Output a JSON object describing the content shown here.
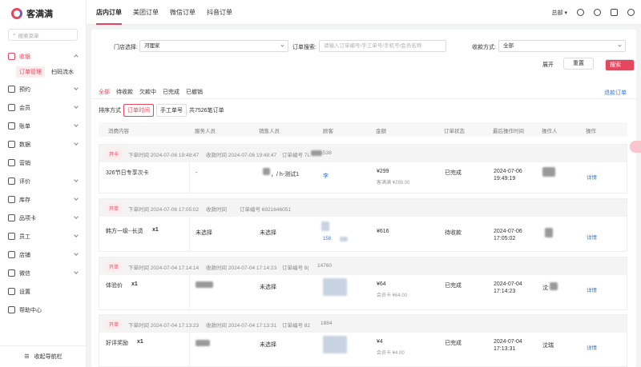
{
  "app": {
    "name": "客满满"
  },
  "sidebar": {
    "search_placeholder": "搜索菜单",
    "items": [
      {
        "label": "收银",
        "icon": "cashier-icon"
      },
      {
        "label": "预约",
        "icon": "calendar-icon"
      },
      {
        "label": "会员",
        "icon": "member-icon"
      },
      {
        "label": "账单",
        "icon": "bill-icon"
      },
      {
        "label": "数据",
        "icon": "data-icon"
      },
      {
        "label": "营销",
        "icon": "marketing-icon"
      },
      {
        "label": "评价",
        "icon": "review-icon"
      },
      {
        "label": "库存",
        "icon": "inventory-icon"
      },
      {
        "label": "品项卡",
        "icon": "card-icon"
      },
      {
        "label": "员工",
        "icon": "staff-icon"
      },
      {
        "label": "店铺",
        "icon": "store-icon"
      },
      {
        "label": "微信",
        "icon": "wechat-icon"
      },
      {
        "label": "设置",
        "icon": "gear-icon"
      },
      {
        "label": "帮助中心",
        "icon": "help-icon"
      }
    ],
    "sub_items": [
      "订单管理",
      "扫码流水"
    ],
    "collapse_label": "收起导航栏"
  },
  "topbar": {
    "tabs": [
      "店内订单",
      "美团订单",
      "微信订单",
      "抖音订单"
    ],
    "account": "总部"
  },
  "filters": {
    "store_label": "门店选择:",
    "store_value": "河狸家",
    "order_search_label": "订单搜索:",
    "order_search_placeholder": "请输入订单编号/手工单号/手机号/会员名称",
    "pay_label": "收款方式:",
    "pay_value": "全部",
    "expand": "展开",
    "reset": "重置",
    "search": "搜索"
  },
  "status_tabs": [
    "全部",
    "待收款",
    "欠款中",
    "已完成",
    "已撤销"
  ],
  "refund_link": "退款订单",
  "sort": {
    "label": "排序方式",
    "by_time": "订单时间",
    "by_manual": "手工单号",
    "total": "共7526笔订单"
  },
  "columns": [
    "消费内容",
    "服务人员",
    "销售人员",
    "顾客",
    "金额",
    "订单状态",
    "最后操作时间",
    "操作人",
    "操作"
  ],
  "orders": [
    {
      "tag": "开卡",
      "order_time": "下单时间 2024-07-06 19:48:47",
      "pay_time": "收款时间 2024-07-06 19:48:47",
      "order_no": "订单编号 7L",
      "order_no_tail": "538",
      "content": "326节日专享次卡",
      "qty": "",
      "staff": "-",
      "sales": "，/ h-测试1",
      "customer": "李",
      "amount": "¥299",
      "amount_sub": "客满满 ¥299.00",
      "status": "已完成",
      "last_date": "2024-07-06",
      "last_time": "19:49:19",
      "operator": "",
      "action": "详情"
    },
    {
      "tag": "开单",
      "order_time": "下单时间 2024-07-06 17:05:02",
      "pay_time": "收款时间",
      "order_no": "订单编号 6921646051",
      "order_no_tail": "",
      "content": "韩方一级--长烫",
      "qty": "x1",
      "staff": "未选择",
      "sales": "未选择",
      "customer": "158",
      "amount": "¥616",
      "amount_sub": "",
      "status": "待收款",
      "last_date": "2024-07-06",
      "last_time": "17:05:02",
      "operator": "",
      "action": "详情"
    },
    {
      "tag": "开单",
      "order_time": "下单时间 2024-07-04 17:14:14",
      "pay_time": "收款时间 2024-07-04 17:14:23",
      "order_no": "订单编号 8(",
      "order_no_tail": "14760",
      "content": "体验价",
      "qty": "x1",
      "staff": "",
      "sales": "未选择",
      "customer": "",
      "amount": "¥64",
      "amount_sub": "会员卡 ¥64.00",
      "status": "已完成",
      "last_date": "2024-07-04",
      "last_time": "17:14:23",
      "operator": "沈",
      "action": "详情"
    },
    {
      "tag": "开单",
      "order_time": "下单时间 2024-07-04 17:13:23",
      "pay_time": "收款时间 2024-07-04 17:13:31",
      "order_no": "订单编号 82",
      "order_no_tail": "1884",
      "content": "好评奖励",
      "qty": "x1",
      "staff": "",
      "sales": "未选择",
      "customer": "",
      "amount": "¥4",
      "amount_sub": "会员卡 ¥4.00",
      "status": "已完成",
      "last_date": "2024-07-04",
      "last_time": "17:13:31",
      "operator": "沈瑞",
      "action": "详情"
    }
  ],
  "colors": {
    "accent": "#e4475e",
    "link": "#3a7ad9"
  }
}
